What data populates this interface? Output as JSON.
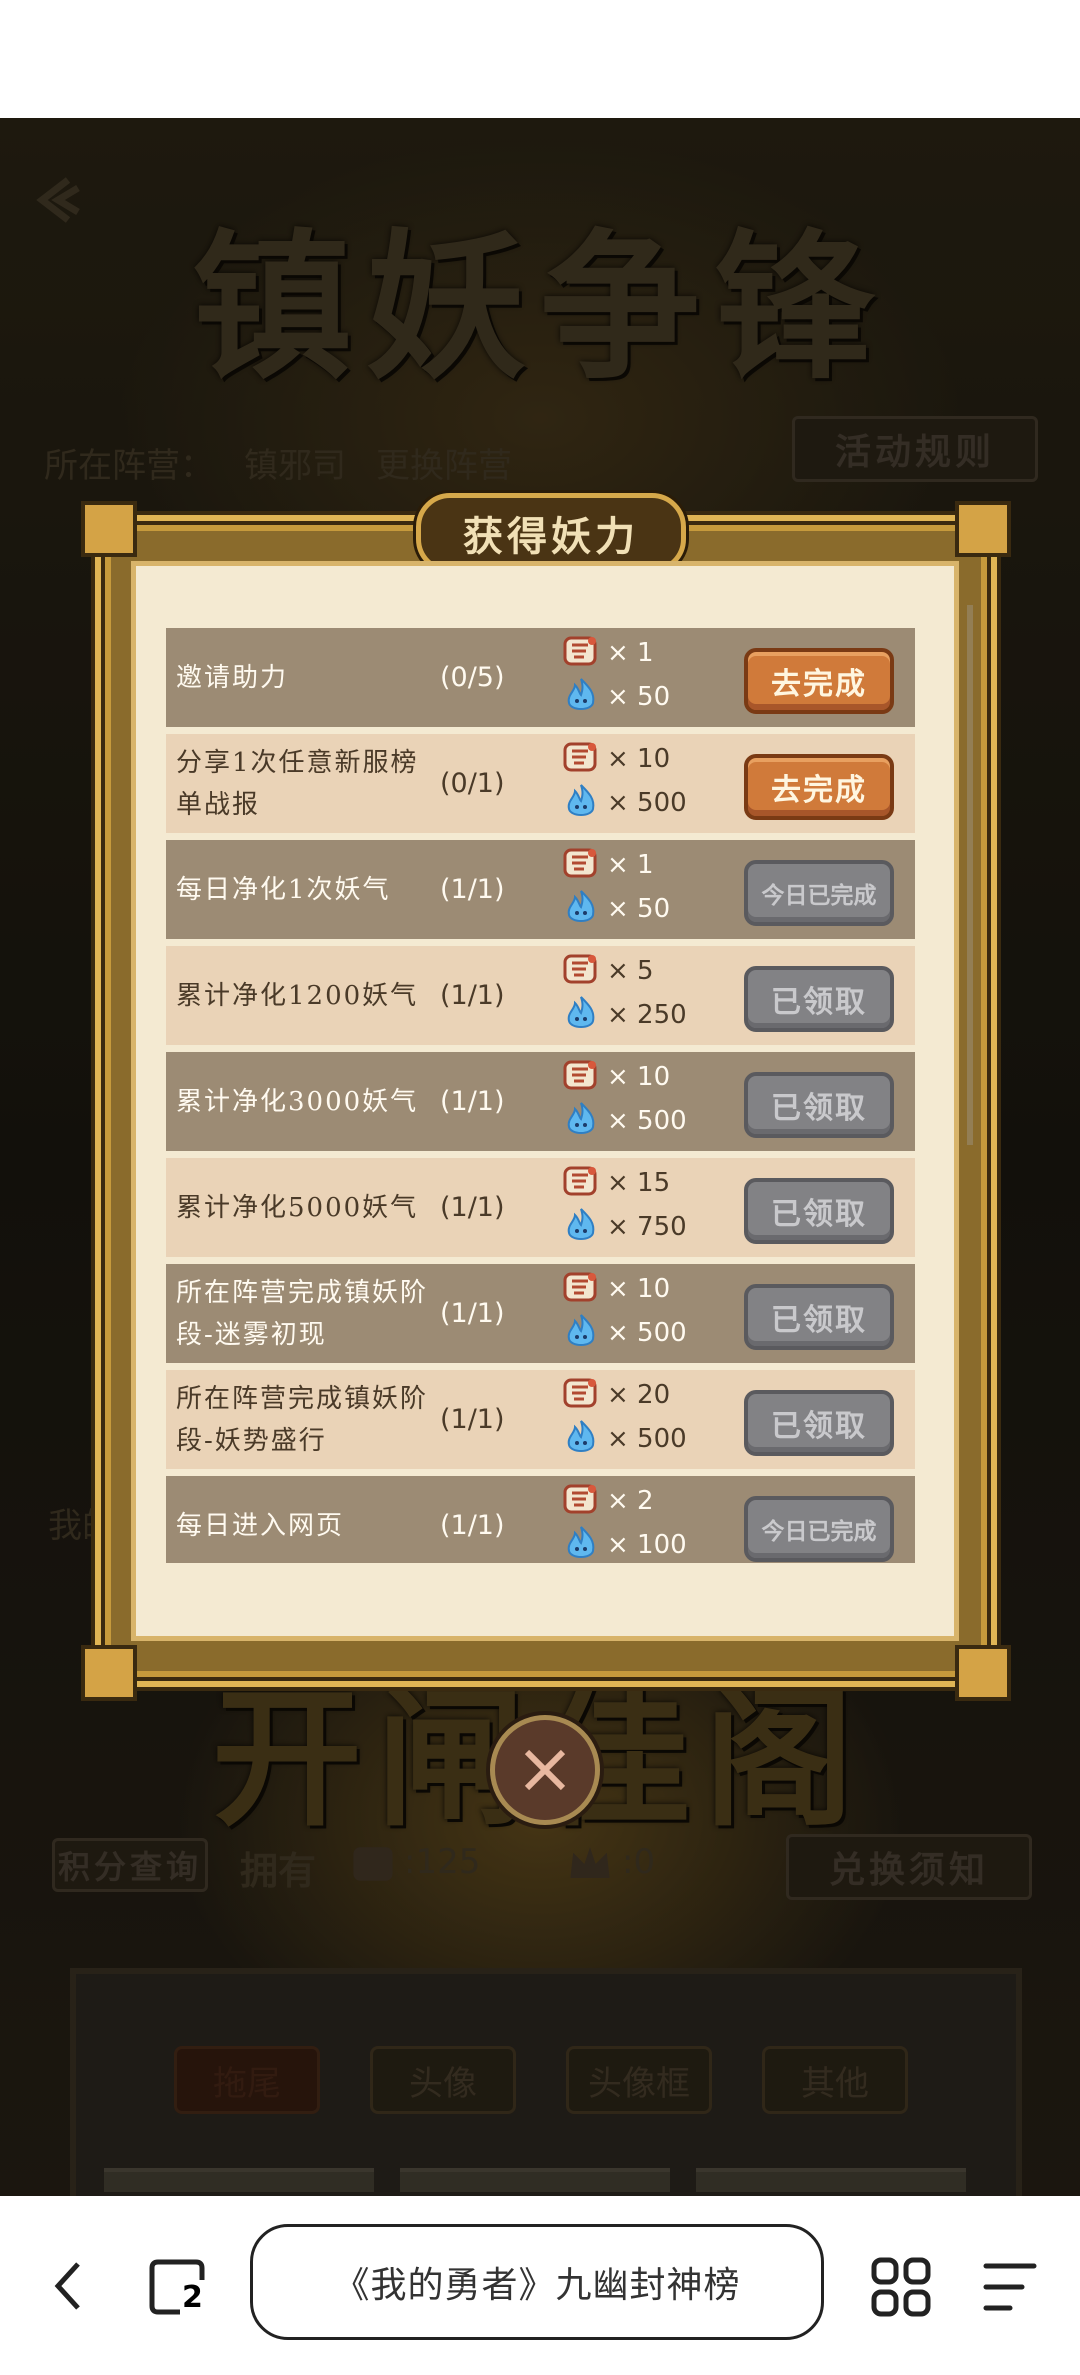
{
  "background": {
    "title_top": "镇妖争锋",
    "title_mid": "开闸佳阁",
    "camp_label": "所在阵营：",
    "camp_value": "镇邪司",
    "change_camp": "更换阵营",
    "rules_button": "活动规则",
    "points_query": "积分查询",
    "own_label": "拥有",
    "token_count": ":125",
    "crown_count": ":0",
    "exchange_notice": "兑换须知",
    "my_label": "我的",
    "tabs": [
      "拖尾",
      "头像",
      "头像框",
      "其他"
    ]
  },
  "modal": {
    "title": "获得妖力",
    "tasks": [
      {
        "name": "邀请助力",
        "progress": "(0/5)",
        "reward1": "× 1",
        "reward2": "× 50",
        "button": "去完成",
        "state": "go",
        "shade": "dark"
      },
      {
        "name": "分享1次任意新服榜单战报",
        "progress": "(0/1)",
        "reward1": "× 10",
        "reward2": "× 500",
        "button": "去完成",
        "state": "go",
        "shade": "light"
      },
      {
        "name": "每日净化1次妖气",
        "progress": "(1/1)",
        "reward1": "× 1",
        "reward2": "× 50",
        "button": "今日已完成",
        "state": "done",
        "shade": "dark"
      },
      {
        "name": "累计净化1200妖气",
        "progress": "(1/1)",
        "reward1": "× 5",
        "reward2": "× 250",
        "button": "已领取",
        "state": "done",
        "shade": "light"
      },
      {
        "name": "累计净化3000妖气",
        "progress": "(1/1)",
        "reward1": "× 10",
        "reward2": "× 500",
        "button": "已领取",
        "state": "done",
        "shade": "dark"
      },
      {
        "name": "累计净化5000妖气",
        "progress": "(1/1)",
        "reward1": "× 15",
        "reward2": "× 750",
        "button": "已领取",
        "state": "done",
        "shade": "light"
      },
      {
        "name": "所在阵营完成镇妖阶段-迷雾初现",
        "progress": "(1/1)",
        "reward1": "× 10",
        "reward2": "× 500",
        "button": "已领取",
        "state": "done",
        "shade": "dark"
      },
      {
        "name": "所在阵营完成镇妖阶段-妖势盛行",
        "progress": "(1/1)",
        "reward1": "× 20",
        "reward2": "× 500",
        "button": "已领取",
        "state": "done",
        "shade": "light"
      },
      {
        "name": "每日进入网页",
        "progress": "(1/1)",
        "reward1": "× 2",
        "reward2": "× 100",
        "button": "今日已完成",
        "state": "done",
        "shade": "dark"
      }
    ]
  },
  "browser": {
    "url_title": "《我的勇者》九幽封神榜",
    "tab_count": "2"
  },
  "colors": {
    "go_button": "#d07a3a",
    "done_button": "#828285",
    "row_dark": "#9c8b74",
    "row_light": "#ead3b7",
    "modal_paper": "#f4ead2"
  }
}
